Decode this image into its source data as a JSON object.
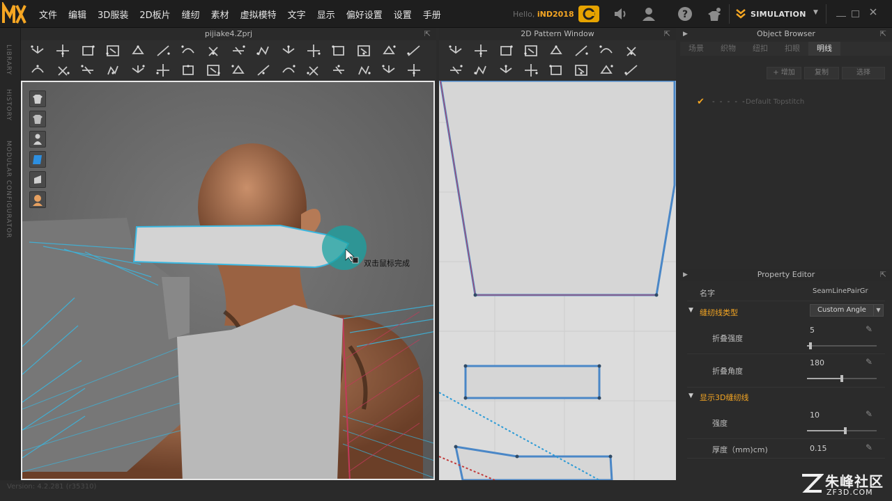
{
  "menu": [
    "文件",
    "编辑",
    "3D服装",
    "2D板片",
    "缝纫",
    "素材",
    "虚拟模特",
    "文字",
    "显示",
    "偏好设置",
    "设置",
    "手册"
  ],
  "user": {
    "hello": "Hello",
    "name": "iND2018"
  },
  "mode": {
    "label": "SIMULATION"
  },
  "side_tabs": [
    "LIBRARY",
    "HISTORY",
    "MODULAR CONFIGURATOR"
  ],
  "view3d": {
    "title": "pijiake4.Zprj",
    "tooltip": "双击鼠标完成"
  },
  "view2d": {
    "title": "2D Pattern Window"
  },
  "object_browser": {
    "title": "Object Browser",
    "tabs": [
      "场景",
      "织物",
      "纽扣",
      "扣眼",
      "明线"
    ],
    "active_tab": "明线",
    "buttons": {
      "add": "+ 增加",
      "copy": "复制",
      "delete": "选择"
    },
    "item": {
      "dashes": "- - - - -",
      "name": "Default Topstitch"
    }
  },
  "property_editor": {
    "title": "Property Editor",
    "name_label": "名字",
    "name_value": "SeamLinePairGr",
    "section1": "缝纫线类型",
    "seam_type": "Custom Angle",
    "fold_strength_label": "折叠强度",
    "fold_strength_value": "5",
    "fold_strength_fraction": 0.05,
    "fold_angle_label": "折叠角度",
    "fold_angle_value": "180",
    "fold_angle_fraction": 0.5,
    "section2": "显示3D缝纫线",
    "strength_label": "强度",
    "strength_value": "10",
    "strength_fraction": 0.55,
    "thickness_label": "厚度（mm)cm)",
    "thickness_value": "0.15"
  },
  "status": {
    "version": "Version: 4.2.281 (r35310)"
  },
  "watermark": {
    "main": "朱峰社区",
    "sub": "ZF3D.COM"
  },
  "colors": {
    "accent": "#f5a623",
    "seam": "#3ab7e0",
    "pattern": "#d9d9d9"
  }
}
